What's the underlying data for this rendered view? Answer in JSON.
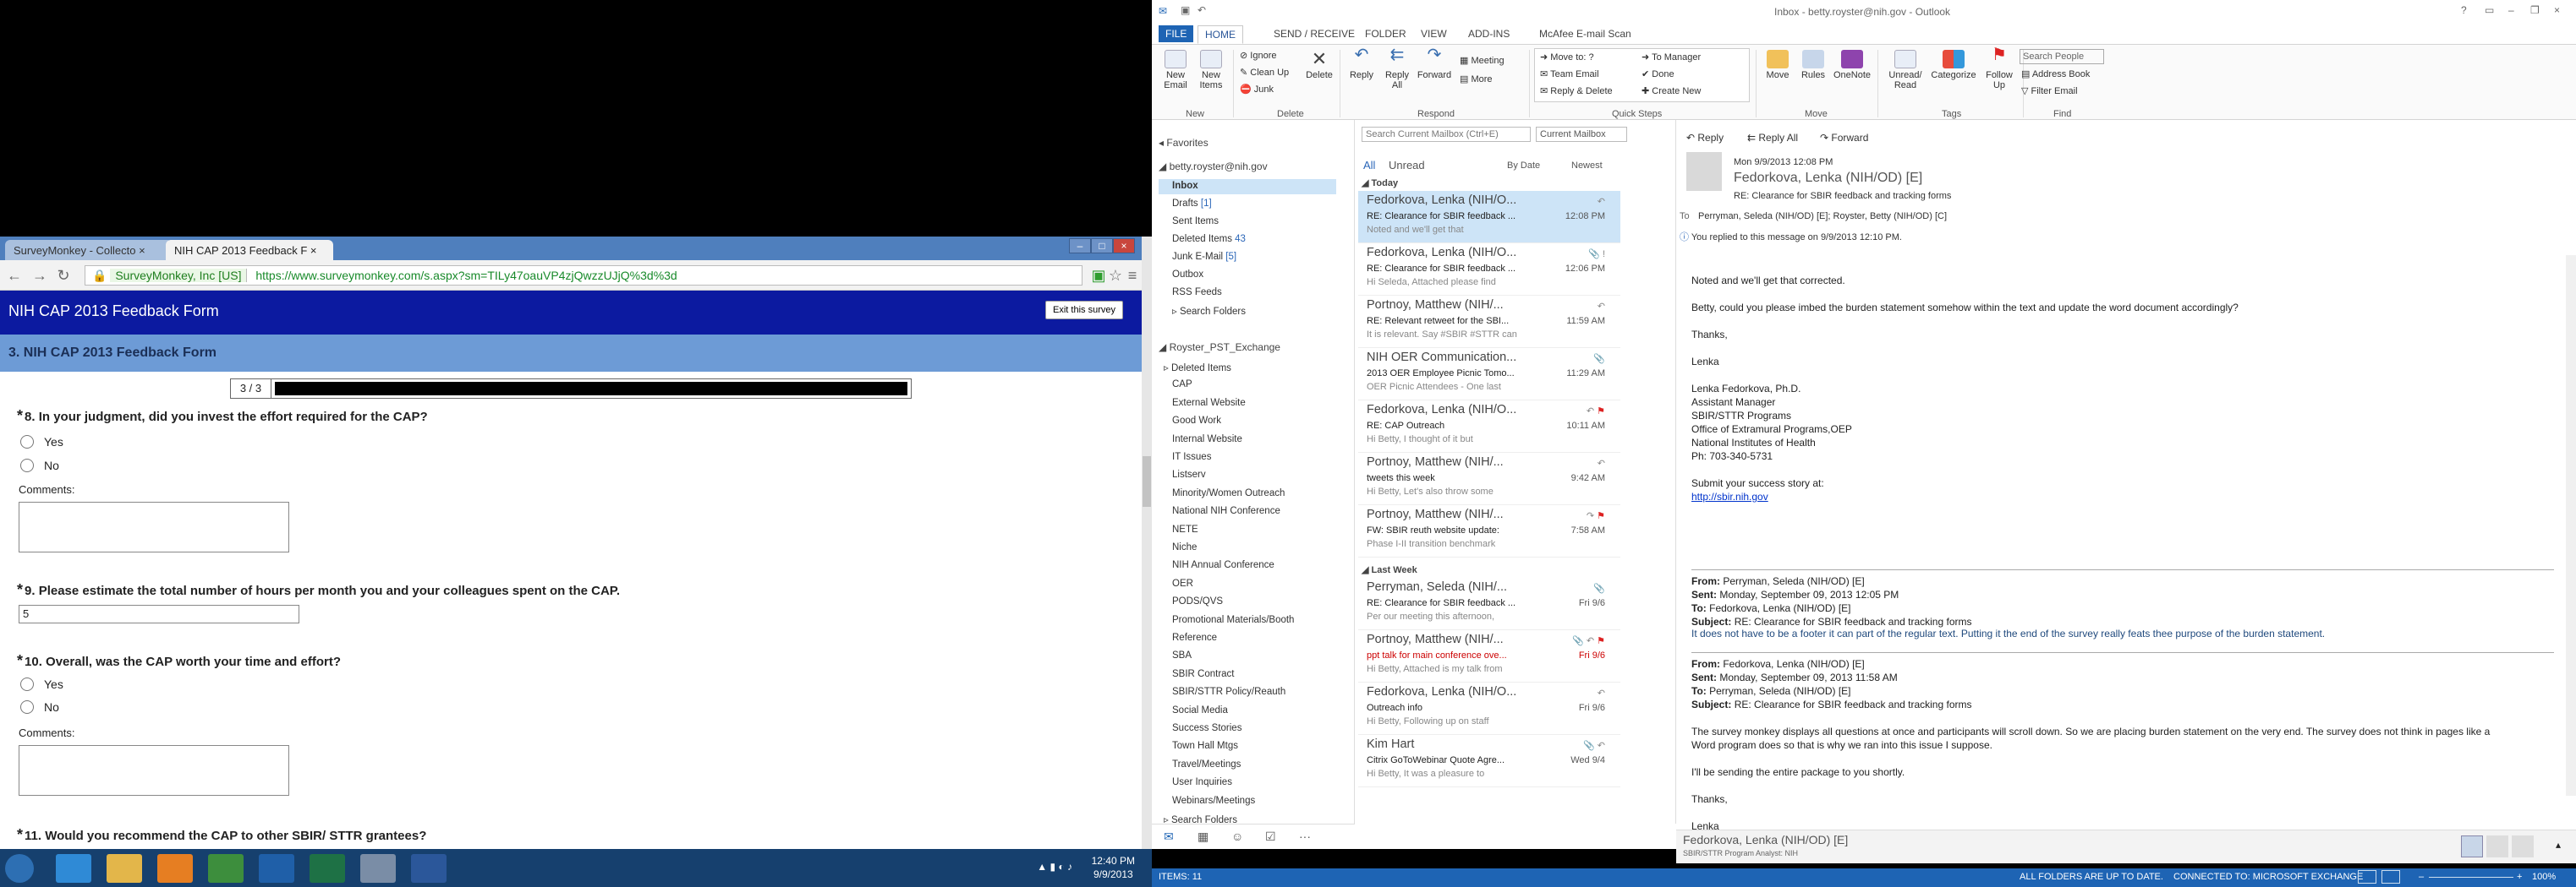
{
  "chrome": {
    "tab1": "SurveyMonkey - Collecto",
    "tab2": "NIH CAP 2013 Feedback F",
    "ev_label": "SurveyMonkey, Inc [US]",
    "url": "https://www.surveymonkey.com/s.aspx?sm=TILy47oauVP4zjQwzzUJjQ%3d%3d"
  },
  "survey": {
    "title": "NIH CAP 2013 Feedback Form",
    "exit": "Exit this survey",
    "subtitle": "3. NIH CAP 2013 Feedback Form",
    "progress_label": "3 / 3",
    "progress_fraction": 1.0,
    "q8": "8. In your judgment, did you invest the effort required for the CAP?",
    "q9": "9. Please estimate the total number of hours per month you and your colleagues spent on the CAP.",
    "q9_value": "5",
    "q10": "10. Overall, was the CAP worth your time and effort?",
    "q11": "11. Would you recommend the CAP to other SBIR/ STTR grantees?",
    "yes": "Yes",
    "no": "No",
    "comments": "Comments:"
  },
  "outlook": {
    "window_title": "Inbox - betty.royster@nih.gov - Outlook",
    "tabs": [
      "FILE",
      "HOME",
      "SEND / RECEIVE",
      "FOLDER",
      "VIEW",
      "ADD-INS",
      "McAfee E-mail Scan"
    ],
    "ribbon": {
      "new_email": "New Email",
      "new_items": "New Items",
      "ignore": "Ignore",
      "clean_up": "Clean Up",
      "junk": "Junk",
      "delete": "Delete",
      "reply": "Reply",
      "reply_all": "Reply All",
      "forward": "Forward",
      "meeting": "Meeting",
      "more": "More",
      "move_to": "Move to: ?",
      "team_email": "Team Email",
      "reply_delete": "Reply & Delete",
      "to_manager": "To Manager",
      "done": "Done",
      "create_new": "Create New",
      "move": "Move",
      "rules": "Rules",
      "onenote": "OneNote",
      "unread_read": "Unread/ Read",
      "categorize": "Categorize",
      "follow_up": "Follow Up",
      "search_people": "Search People",
      "address_book": "Address Book",
      "filter_email": "Filter Email",
      "groups": [
        "New",
        "Delete",
        "Respond",
        "Quick Steps",
        "Move",
        "Tags",
        "Find"
      ]
    },
    "folders": {
      "favorites": "Favorites",
      "account": "betty.royster@nih.gov",
      "inbox": "Inbox",
      "drafts": "Drafts",
      "drafts_count": "[1]",
      "sent": "Sent Items",
      "deleted": "Deleted Items",
      "deleted_count": "43",
      "junk": "Junk E-Mail",
      "junk_count": "[5]",
      "outbox": "Outbox",
      "rss": "RSS Feeds",
      "search": "Search Folders",
      "pst": "Royster_PST_Exchange",
      "pst_items": [
        "Deleted Items",
        "CAP",
        "External Website",
        "Good Work",
        "Internal Website",
        "IT Issues",
        "Listserv",
        "Minority/Women Outreach",
        "National NIH Conference",
        "NETE",
        "Niche",
        "NIH Annual Conference",
        "OER",
        "PODS/QVS",
        "Promotional Materials/Booth",
        "Reference",
        "SBA",
        "SBIR Contract",
        "SBIR/STTR Policy/Reauth",
        "Social Media",
        "Success Stories",
        "Town Hall Mtgs",
        "Travel/Meetings",
        "User Inquiries",
        "Webinars/Meetings",
        "Search Folders"
      ]
    },
    "list": {
      "search_placeholder": "Search Current Mailbox (Ctrl+E)",
      "scope": "Current Mailbox",
      "all": "All",
      "unread": "Unread",
      "by_date": "By Date",
      "newest": "Newest",
      "today": "Today",
      "last_week": "Last Week",
      "messages": [
        {
          "sender": "Fedorkova, Lenka (NIH/O...",
          "subject": "RE: Clearance for SBIR feedback ...",
          "preview": "Noted and we'll get that",
          "time": "12:08 PM"
        },
        {
          "sender": "Fedorkova, Lenka (NIH/O...",
          "subject": "RE: Clearance for SBIR feedback ...",
          "preview": "Hi Seleda,  Attached please find",
          "time": "12:06 PM"
        },
        {
          "sender": "Portnoy, Matthew (NIH/...",
          "subject": "RE: Relevant retweet for the SBI...",
          "preview": "It is relevant.  Say #SBIR #STTR can",
          "time": "11:59 AM"
        },
        {
          "sender": "NIH OER Communication...",
          "subject": "2013 OER Employee Picnic Tomo...",
          "preview": "OER Picnic Attendees -  One last",
          "time": "11:29 AM"
        },
        {
          "sender": "Fedorkova, Lenka (NIH/O...",
          "subject": "RE: CAP Outreach",
          "preview": "Hi Betty,  I thought of it but",
          "time": "10:11 AM"
        },
        {
          "sender": "Portnoy, Matthew (NIH/...",
          "subject": "tweets this week",
          "preview": "Hi Betty,  Let's also throw some",
          "time": "9:42 AM"
        },
        {
          "sender": "Portnoy, Matthew (NIH/...",
          "subject": "FW: SBIR reuth website update:",
          "preview": "Phase I-II transition benchmark",
          "time": "7:58 AM"
        },
        {
          "sender": "Perryman, Seleda (NIH/...",
          "subject": "RE: Clearance for SBIR feedback ...",
          "preview": "Per our meeting this afternoon,",
          "time": "Fri 9/6"
        },
        {
          "sender": "Portnoy, Matthew (NIH/...",
          "subject": "ppt talk for main conference ove...",
          "preview": "Hi Betty,  Attached is my talk from",
          "time": "Fri 9/6"
        },
        {
          "sender": "Fedorkova, Lenka (NIH/O...",
          "subject": "Outreach info",
          "preview": "Hi Betty,  Following up on staff",
          "time": "Fri 9/6"
        },
        {
          "sender": "Kim Hart",
          "subject": "Citrix GoToWebinar Quote Agre...",
          "preview": "Hi  Betty,  It was a pleasure to",
          "time": "Wed 9/4"
        }
      ]
    },
    "reading": {
      "reply": "Reply",
      "reply_all": "Reply All",
      "forward": "Forward",
      "date": "Mon 9/9/2013 12:08 PM",
      "from": "Fedorkova, Lenka (NIH/OD) [E]",
      "subject": "RE: Clearance for SBIR feedback and tracking forms",
      "to_label": "To",
      "to": "Perryman, Seleda (NIH/OD) [E]; Royster, Betty (NIH/OD) [C]",
      "info": "You replied to this message on 9/9/2013 12:10 PM.",
      "body": [
        "Noted and we'll get that corrected.",
        "Betty, could you please imbed the burden statement somehow within the text and update the word document accordingly?",
        "Thanks,",
        "Lenka",
        "Lenka Fedorkova, Ph.D.",
        "Assistant Manager",
        "SBIR/STTR Programs",
        "Office of Extramural Programs,OEP",
        "National Institutes of Health",
        "Ph: 703-340-5731",
        "Submit your success story at:",
        "http://sbir.nih.gov"
      ],
      "q1": {
        "from_label": "From:",
        "from": "Perryman, Seleda (NIH/OD) [E]",
        "sent_label": "Sent:",
        "sent": "Monday, September 09, 2013 12:05 PM",
        "to_label": "To:",
        "to": "Fedorkova, Lenka (NIH/OD) [E]",
        "subject_label": "Subject:",
        "subject": "RE: Clearance for SBIR feedback and tracking forms",
        "body": "It does not have to be a footer it can part of the regular text. Putting it the end of the survey really feats thee purpose of the burden statement."
      },
      "q2": {
        "from_label": "From:",
        "from": "Fedorkova, Lenka (NIH/OD) [E]",
        "sent_label": "Sent:",
        "sent": "Monday, September 09, 2013 11:58 AM",
        "to_label": "To:",
        "to": "Perryman, Seleda (NIH/OD) [E]",
        "subject_label": "Subject:",
        "subject": "RE: Clearance for SBIR feedback and tracking forms",
        "body1": "The survey monkey displays all questions at once and participants will scroll down. So we are placing burden statement on the very end. The survey does not think in pages like a",
        "body2": "Word program does so that is why we ran into this issue I suppose.",
        "body3": "I'll be sending the entire package to you shortly.",
        "thanks": "Thanks,",
        "sig": "Lenka"
      },
      "people_name": "Fedorkova, Lenka (NIH/OD) [E]",
      "people_title": "SBIR/STTR Program Analyst: NIH"
    },
    "status": {
      "items": "ITEMS: 11",
      "sync": "ALL FOLDERS ARE UP TO DATE.",
      "conn": "CONNECTED TO: MICROSOFT EXCHANGE",
      "zoom": "100%"
    }
  },
  "taskbar": {
    "time": "12:40 PM",
    "date": "9/9/2013"
  }
}
